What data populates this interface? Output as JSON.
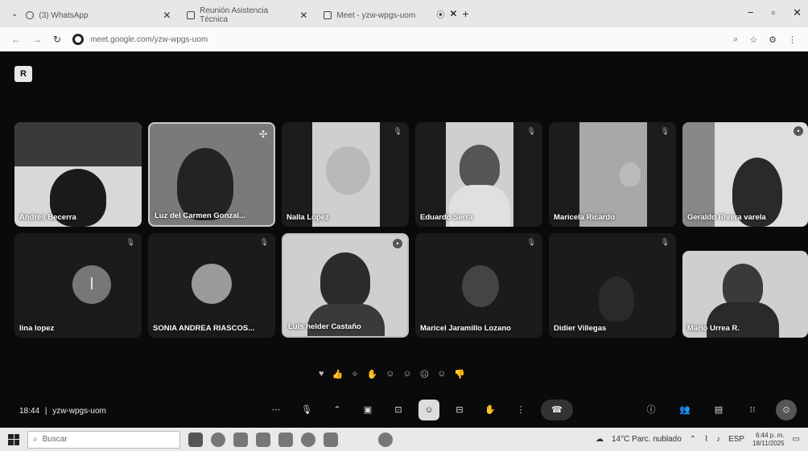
{
  "browser": {
    "tabs": [
      {
        "label": "(3) WhatsApp",
        "active": false
      },
      {
        "label": "Reunión Asistencia Técnica",
        "active": false
      },
      {
        "label": "Meet - yzw-wpgs-uom",
        "active": true
      }
    ],
    "url": "meet.google.com/yzw-wpgs-uom"
  },
  "meet": {
    "participants": [
      {
        "name": "Andres Becerra"
      },
      {
        "name": "Luz del Carmen Gonzal..."
      },
      {
        "name": "Nalla Lopez"
      },
      {
        "name": "Eduardo Serra"
      },
      {
        "name": "Maricela Ricardo"
      },
      {
        "name": "Geraldo Rivera varela"
      },
      {
        "name": "lina lopez",
        "initial": "l"
      },
      {
        "name": "SONIA ANDREA RIASCOS..."
      },
      {
        "name": "Luis helder Castaño"
      },
      {
        "name": "Maricel Jaramillo Lozano"
      },
      {
        "name": "Didier Villegas"
      },
      {
        "name": "Mario Urrea R."
      }
    ],
    "time": "18:44",
    "code": "yzw-wpgs-uom",
    "separator": "|"
  },
  "taskbar": {
    "search_placeholder": "Buscar",
    "weather": "14°C Parc. nublado",
    "lang": "ESP",
    "time": "6:44 p. m.",
    "date": "18/11/2025"
  }
}
